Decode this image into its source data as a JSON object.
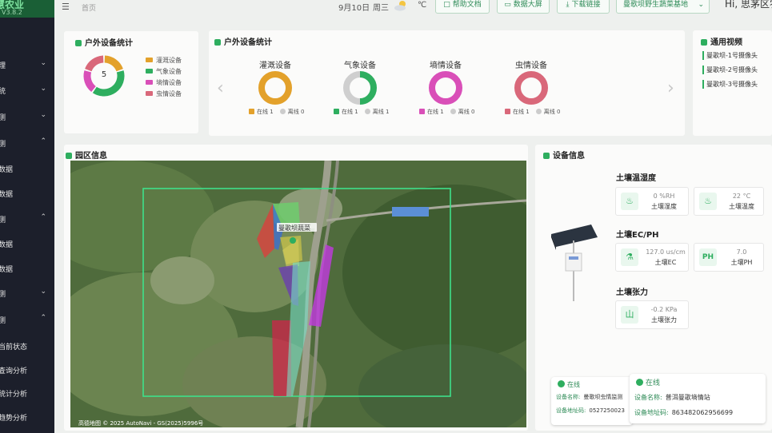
{
  "sidebar": {
    "brand_title": "慧农业",
    "brand_version": "V3.8.2",
    "items": [
      {
        "label": "理",
        "chevron": "⌄"
      },
      {
        "label": "统",
        "chevron": "⌄"
      },
      {
        "label": "测",
        "chevron": "⌄"
      },
      {
        "label": "测",
        "chevron": "⌃"
      },
      {
        "label": "数据",
        "chevron": ""
      },
      {
        "label": "数据",
        "chevron": ""
      },
      {
        "label": "测",
        "chevron": "⌃"
      },
      {
        "label": "数据",
        "chevron": ""
      },
      {
        "label": "数据",
        "chevron": ""
      },
      {
        "label": "测",
        "chevron": "⌄"
      },
      {
        "label": "测",
        "chevron": "⌃"
      },
      {
        "label": "当前状态",
        "chevron": ""
      },
      {
        "label": "查询分析",
        "chevron": ""
      },
      {
        "label": "统计分析",
        "chevron": ""
      },
      {
        "label": "趋势分析",
        "chevron": ""
      }
    ]
  },
  "header": {
    "breadcrumb": "首页",
    "date": "9月10日",
    "weekday": "周三",
    "temperature_unit": "℃",
    "buttons": [
      {
        "label": "帮助文档",
        "icon": "□"
      },
      {
        "label": "数据大屏",
        "icon": "▭"
      },
      {
        "label": "下载链接",
        "icon": "⤓"
      }
    ],
    "farm_select": "曼歌坝野生蔬菜基地",
    "greeting": "Hi, 思茅区农"
  },
  "stats_panel": {
    "title": "户外设备统计",
    "donut_total": "5",
    "legend": [
      {
        "label": "灌溉设备",
        "color": "#e3a12b"
      },
      {
        "label": "气象设备",
        "color": "#2eae5f"
      },
      {
        "label": "墒情设备",
        "color": "#d94fb8"
      },
      {
        "label": "虫情设备",
        "color": "#d9687a"
      }
    ]
  },
  "device_panel": {
    "title": "户外设备统计",
    "online_label": "在线",
    "offline_label": "离线",
    "devices": [
      {
        "name": "灌溉设备",
        "color": "#e3a12b",
        "online": "1",
        "offline": "0",
        "online_fraction": 1
      },
      {
        "name": "气象设备",
        "color": "#2eae5f",
        "online": "1",
        "offline": "1",
        "online_fraction": 0.5
      },
      {
        "name": "墒情设备",
        "color": "#d94fb8",
        "online": "1",
        "offline": "0",
        "online_fraction": 1
      },
      {
        "name": "虫情设备",
        "color": "#d9687a",
        "online": "1",
        "offline": "0",
        "online_fraction": 1
      }
    ]
  },
  "video_panel": {
    "title": "通用视频",
    "items": [
      "曼歌坝-1号摄像头",
      "曼歌坝-2号摄像头",
      "曼歌坝-3号摄像头"
    ]
  },
  "park_panel": {
    "title": "园区信息",
    "map_label": "曼歌坝蔬菜",
    "map_credit": "高德地图 © 2025 AutoNavi - GS(2025)5996号"
  },
  "device_info": {
    "title": "设备信息",
    "sections": {
      "temp_humidity": "土壤温湿度",
      "ec_ph": "土壤EC/PH",
      "tension": "土壤张力"
    },
    "readings": {
      "humidity": {
        "value": "0 %RH",
        "name": "土壤湿度",
        "icon": "♨"
      },
      "temperature": {
        "value": "22 °C",
        "name": "土壤温度",
        "icon": "♨"
      },
      "ec": {
        "value": "127.0 us/cm",
        "name": "土壤EC",
        "icon": "⚗"
      },
      "ph": {
        "value": "7.0",
        "name": "土壤PH",
        "icon": "PH"
      },
      "tension": {
        "value": "-0.2 KPa",
        "name": "土壤张力",
        "icon": "山"
      }
    }
  },
  "popup_back": {
    "status": "在线",
    "name_key": "设备名称:",
    "name_value": "曼歌坝虫情监测",
    "addr_key": "设备地址码:",
    "addr_value": "0527250023"
  },
  "popup_front": {
    "status": "在线",
    "name_key": "设备名称:",
    "name_value": "普洱曼歌墒情站",
    "addr_key": "设备地址码:",
    "addr_value": "863482062956699"
  },
  "colors": {
    "accent": "#2eae5f",
    "sidebar_bg": "#1c1f2b",
    "brand_bg": "#1a5f36"
  }
}
